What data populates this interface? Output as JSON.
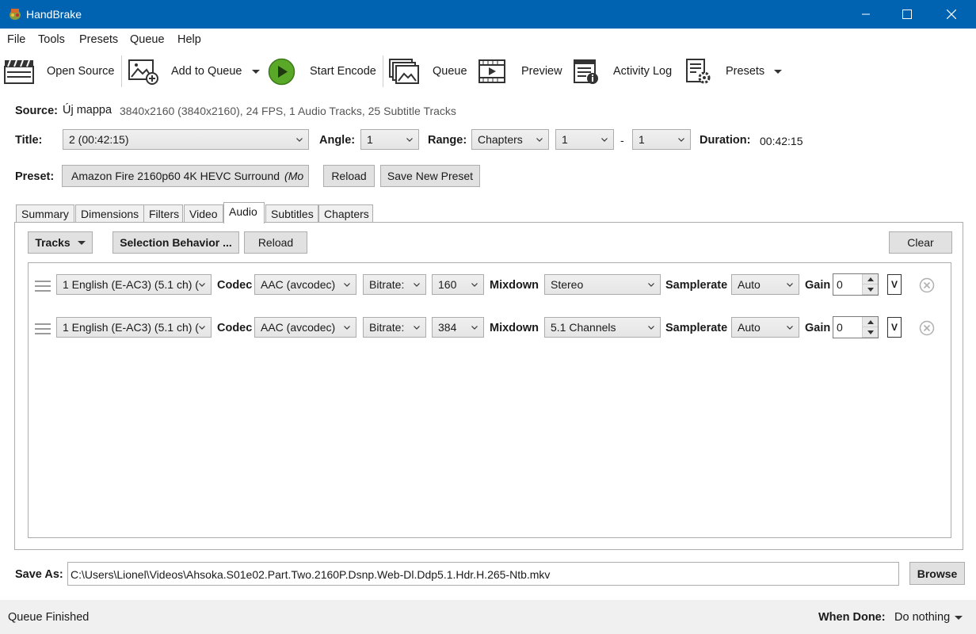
{
  "window": {
    "title": "HandBrake"
  },
  "menu": [
    "File",
    "Tools",
    "Presets",
    "Queue",
    "Help"
  ],
  "toolbar": {
    "open_source": "Open Source",
    "add_to_queue": "Add to Queue",
    "start_encode": "Start Encode",
    "queue": "Queue",
    "preview": "Preview",
    "activity_log": "Activity Log",
    "presets": "Presets"
  },
  "source": {
    "label": "Source:",
    "name": "Új mappa",
    "info": "3840x2160 (3840x2160), 24 FPS, 1 Audio Tracks, 25 Subtitle Tracks"
  },
  "title_row": {
    "title_label": "Title:",
    "title_value": "2  (00:42:15)",
    "angle_label": "Angle:",
    "angle_value": "1",
    "range_label": "Range:",
    "range_type": "Chapters",
    "range_start": "1",
    "range_sep": "-",
    "range_end": "1",
    "duration_label": "Duration:",
    "duration_value": "00:42:15"
  },
  "preset": {
    "label": "Preset:",
    "value": "Amazon Fire 2160p60 4K HEVC Surround",
    "value_suffix": "(Mo",
    "reload": "Reload",
    "save_new": "Save New Preset"
  },
  "tabs": [
    "Summary",
    "Dimensions",
    "Filters",
    "Video",
    "Audio",
    "Subtitles",
    "Chapters"
  ],
  "active_tab": "Audio",
  "audio": {
    "tracks_button": "Tracks",
    "selection_behavior": "Selection Behavior ...",
    "reload": "Reload",
    "clear": "Clear",
    "labels": {
      "codec": "Codec",
      "mixdown": "Mixdown",
      "samplerate": "Samplerate",
      "gain": "Gain",
      "v": "V"
    },
    "tracks": [
      {
        "source": "1 English (E-AC3) (5.1 ch) (",
        "codec": "AAC (avcodec)",
        "rate_mode": "Bitrate:",
        "bitrate": "160",
        "mixdown": "Stereo",
        "samplerate": "Auto",
        "gain": "0"
      },
      {
        "source": "1 English (E-AC3) (5.1 ch) (",
        "codec": "AAC (avcodec)",
        "rate_mode": "Bitrate:",
        "bitrate": "384",
        "mixdown": "5.1 Channels",
        "samplerate": "Auto",
        "gain": "0"
      }
    ]
  },
  "save_as": {
    "label": "Save As:",
    "path": "C:\\Users\\Lionel\\Videos\\Ahsoka.S01e02.Part.Two.2160P.Dsnp.Web-Dl.Ddp5.1.Hdr.H.265-Ntb.mkv",
    "browse": "Browse"
  },
  "status": {
    "text": "Queue Finished",
    "when_done_label": "When Done:",
    "when_done_value": "Do nothing"
  }
}
